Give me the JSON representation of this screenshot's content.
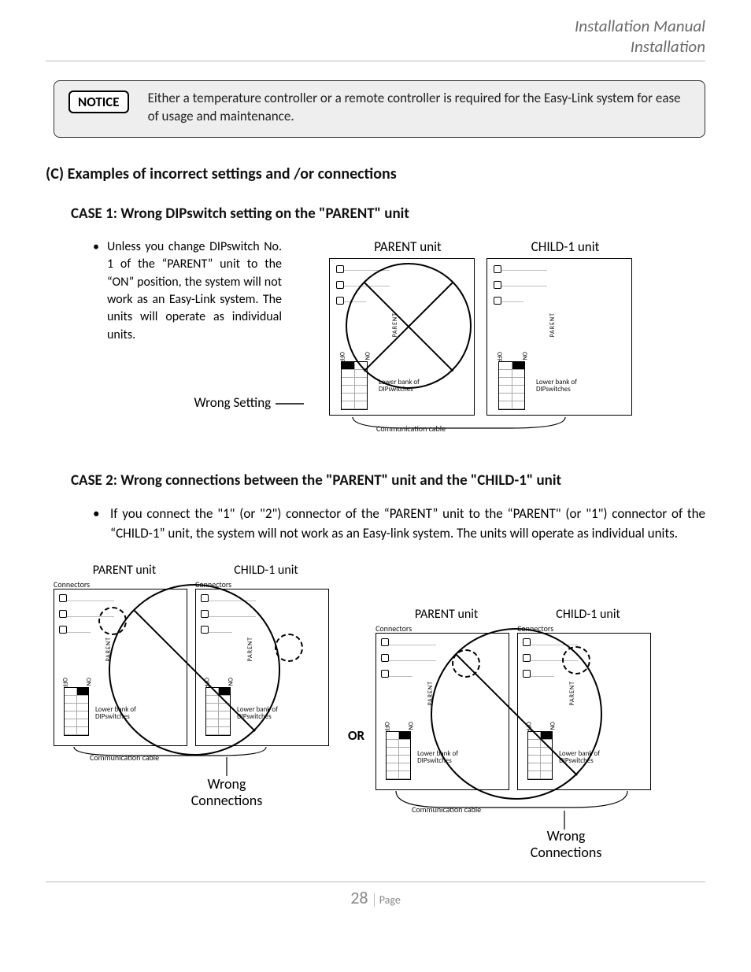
{
  "header": {
    "line1": "Installation Manual",
    "line2": "Installation"
  },
  "notice": {
    "tag": "NOTICE",
    "text": "Either a temperature controller or a remote controller is required for the Easy-Link system for ease of usage and maintenance."
  },
  "section_title": "(C) Examples of incorrect settings and /or connections",
  "case1": {
    "title": "CASE 1: Wrong DIPswitch setting on the \"PARENT\" unit",
    "bullet": "Unless you change DIPswitch No. 1 of the “PARENT” unit to the “ON” position, the system will not work as an Easy-Link system.  The units will operate as individual units.",
    "wrong_setting_label": "Wrong Setting",
    "labels": {
      "parent": "PARENT unit",
      "child": "CHILD-1 unit",
      "comm_cable": "Communication cable",
      "lower_bank": "Lower bank of DIPswitches",
      "off": "OFF",
      "on": "ON",
      "parent_tag": "PARENT"
    }
  },
  "case2": {
    "title": "CASE 2: Wrong connections between the \"PARENT\" unit and the \"CHILD-1\" unit",
    "bullet": "If you connect the \"1\" (or \"2\") connector of the “PARENT” unit to the “PARENT\" (or \"1\") connector of the “CHILD-1” unit, the system will not work as an Easy-link system.  The units will operate as individual units.",
    "or": "OR",
    "labels": {
      "parent": "PARENT unit",
      "child": "CHILD-1 unit",
      "connectors": "Connectors",
      "comm_cable": "Communication cable",
      "lower_bank": "Lower bank of DIPswitches",
      "off": "OFF",
      "on": "ON",
      "parent_tag": "PARENT",
      "wrong_connections": "Wrong Connections"
    }
  },
  "footer": {
    "page_number": "28",
    "page_word": "Page"
  }
}
